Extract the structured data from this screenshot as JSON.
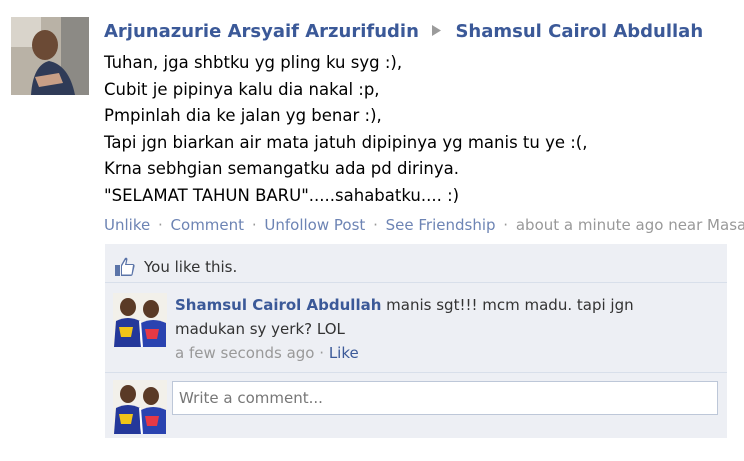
{
  "post": {
    "author": "Arjunazurie Arsyaif Arzurifudin",
    "target": "Shamsul Cairol Abdullah",
    "message_lines": [
      "Tuhan, jga shbtku yg pling ku syg :),",
      "Cubit je pipinya kalu dia nakal :p,",
      "Pmpinlah dia ke jalan yg benar :),",
      "Tapi jgn biarkan air mata jatuh dipipinya yg manis tu ye :(,",
      "Krna sebhgian semangatku ada pd dirinya.",
      "\"SELAMAT TAHUN BARU\".....sahabatku.... :)"
    ]
  },
  "actions": {
    "unlike": "Unlike",
    "comment": "Comment",
    "unfollow": "Unfollow Post",
    "friendship": "See Friendship",
    "separator": "·",
    "time_location": "about a minute ago near Masai"
  },
  "likes": {
    "text": "You like this."
  },
  "comment": {
    "author": "Shamsul Cairol Abdullah",
    "text_line1": "manis sgt!!! mcm madu. tapi jgn",
    "text_line2": "madukan sy yerk? LOL",
    "time": "a few seconds ago",
    "separator": "·",
    "like": "Like"
  },
  "composer": {
    "placeholder": "Write a comment..."
  },
  "icons": {
    "arrow": "triangle-right-icon",
    "like": "thumbs-up-icon"
  },
  "colors": {
    "link": "#3b5998",
    "muted_link": "#6d84b4",
    "ufi_bg": "#edeff4",
    "border": "#d8dfea"
  }
}
